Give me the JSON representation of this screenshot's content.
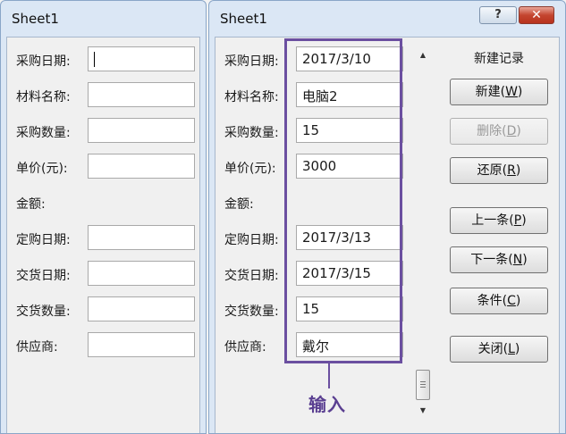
{
  "left_window": {
    "title": "Sheet1",
    "labels": [
      "采购日期:",
      "材料名称:",
      "采购数量:",
      "单价(元):",
      "金额:",
      "定购日期:",
      "交货日期:",
      "交货数量:",
      "供应商:"
    ]
  },
  "right_window": {
    "title": "Sheet1",
    "help_button": "?",
    "close_button": "✕",
    "record_status": "新建记录",
    "fields": [
      {
        "label": "采购日期:",
        "value": "2017/3/10"
      },
      {
        "label": "材料名称:",
        "value": "电脑2"
      },
      {
        "label": "采购数量:",
        "value": "15"
      },
      {
        "label": "单价(元):",
        "value": "3000"
      },
      {
        "label": "金额:",
        "value": ""
      },
      {
        "label": "定购日期:",
        "value": "2017/3/13"
      },
      {
        "label": "交货日期:",
        "value": "2017/3/15"
      },
      {
        "label": "交货数量:",
        "value": "15"
      },
      {
        "label": "供应商:",
        "value": "戴尔"
      }
    ],
    "buttons": {
      "new": {
        "text": "新建",
        "key": "W"
      },
      "delete": {
        "text": "删除",
        "key": "D"
      },
      "restore": {
        "text": "还原",
        "key": "R"
      },
      "prev": {
        "text": "上一条",
        "key": "P"
      },
      "next": {
        "text": "下一条",
        "key": "N"
      },
      "criteria": {
        "text": "条件",
        "key": "C"
      },
      "close": {
        "text": "关闭",
        "key": "L"
      }
    }
  },
  "annotation": {
    "text": "输入",
    "color": "#6b4fa0"
  },
  "icons": {
    "scroll_up": "triangle-up",
    "scroll_down": "triangle-down",
    "scroll_grip": "grip-lines"
  }
}
